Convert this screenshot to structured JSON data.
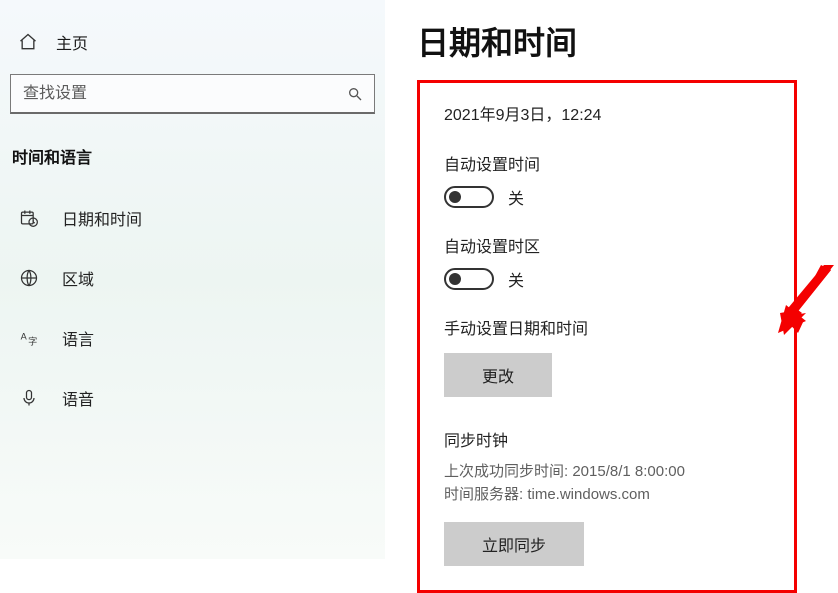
{
  "sidebar": {
    "home_label": "主页",
    "search_placeholder": "查找设置",
    "section_header": "时间和语言",
    "items": [
      {
        "label": "日期和时间"
      },
      {
        "label": "区域"
      },
      {
        "label": "语言"
      },
      {
        "label": "语音"
      }
    ]
  },
  "main": {
    "title": "日期和时间",
    "current_datetime": "2021年9月3日，12:24",
    "auto_time": {
      "label": "自动设置时间",
      "state": "关"
    },
    "auto_tz": {
      "label": "自动设置时区",
      "state": "关"
    },
    "manual": {
      "label": "手动设置日期和时间",
      "button": "更改"
    },
    "sync": {
      "header": "同步时钟",
      "last_line": "上次成功同步时间: 2015/8/1 8:00:00",
      "server_line": "时间服务器: time.windows.com",
      "button": "立即同步"
    }
  }
}
